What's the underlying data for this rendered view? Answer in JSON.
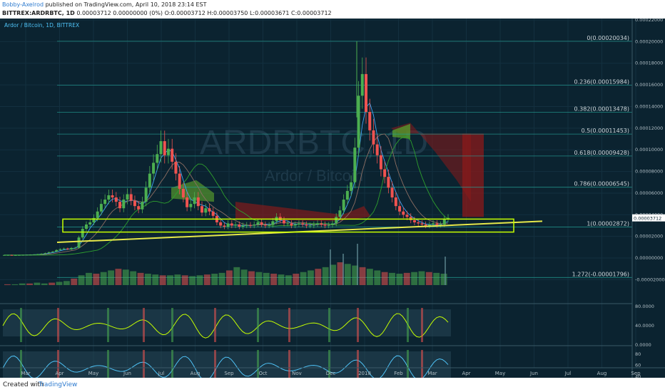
{
  "header": {
    "author": "Bobby-Axelrod",
    "published": " published on TradingView.com, April 10, 2018 23:14 EST",
    "symbol": "BITTREX:ARDRBTC, 1D",
    "ohlc": " 0.00003712 0.00000000 (0%) O:0.00003712 H:0.00003750 L:0.00003671 C:0.00003712"
  },
  "chart_title": "Ardor / Bitcoin, 1D, BITTREX",
  "watermark": {
    "symbol": "ARDRBTC, 1D",
    "name": "Ardor / Bitcoin"
  },
  "footer": {
    "created": "Created with",
    "brand": "TradingView"
  },
  "colors": {
    "background": "#0b2330",
    "candle_up": "#4caf50",
    "candle_down": "#ef5350",
    "fib_line": "#26a69a",
    "trendline": "#e6e84a",
    "support_box": "#c6ff00",
    "cloud_bear": "#8b1a1a",
    "cloud_bull": "#5aa02c",
    "price_tag": "#ffffff"
  },
  "chart_data": [
    {
      "type": "candlestick",
      "title": "Ardor / Bitcoin, 1D, BITTREX",
      "x_tick_labels": [
        "Mar",
        "Apr",
        "May",
        "Jun",
        "Jul",
        "Aug",
        "Sep",
        "Oct",
        "Nov",
        "Dec",
        "2018",
        "Feb",
        "Mar",
        "Apr",
        "May",
        "Jun",
        "Jul",
        "Aug",
        "Sep"
      ],
      "y_tick_labels": [
        "0.00022000",
        "0.00020000",
        "0.00018000",
        "0.00016000",
        "0.00014000",
        "0.00012000",
        "0.00010000",
        "0.00008000",
        "0.00006000",
        "0.00004000",
        "0.00002000",
        "0.00000000",
        "-0.00002000"
      ],
      "ylim": [
        -2.5e-05,
        0.00022
      ],
      "current_price_label": "0.00003712",
      "current_price": 3.712e-05,
      "fib_levels": [
        {
          "label": "0(0.00020034)",
          "value": 0.00020034
        },
        {
          "label": "0.236(0.00015984)",
          "value": 0.00015984
        },
        {
          "label": "0.382(0.00013478)",
          "value": 0.00013478
        },
        {
          "label": "0.5(0.00011453)",
          "value": 0.00011453
        },
        {
          "label": "0.618(0.00009428)",
          "value": 9.428e-05
        },
        {
          "label": "0.786(0.00006545)",
          "value": 6.545e-05
        },
        {
          "label": "1(0.00002872)",
          "value": 2.872e-05
        },
        {
          "label": "1.272(-0.00001796)",
          "value": -1.796e-05
        }
      ],
      "close_series": [
        2.8e-06,
        2.8e-06,
        2.7e-06,
        2.7e-06,
        2.8e-06,
        2.9e-06,
        3e-06,
        3.1e-06,
        3.3e-06,
        3.6e-06,
        4e-06,
        4.6e-06,
        5.4e-06,
        6e-06,
        7.4e-06,
        8.2e-06,
        8.8e-06,
        8e-06,
        9.3e-06,
        9.5e-06,
        1.9e-05,
        2.7e-05,
        3.1e-05,
        3.3e-05,
        3.7e-05,
        4.3e-05,
        5e-05,
        5.4e-05,
        5.8e-05,
        5.6e-05,
        5.2e-05,
        4.6e-05,
        5.4e-05,
        5.9e-05,
        5.3e-05,
        4.8e-05,
        4.5e-05,
        5.2e-05,
        6.5e-05,
        7.8e-05,
        8.8e-05,
        9.6e-05,
        0.000108,
        9.5e-05,
        0.000101,
        8.9e-05,
        7.8e-05,
        6.4e-05,
        5.6e-05,
        4.7e-05,
        5e-05,
        5.6e-05,
        4.8e-05,
        4.2e-05,
        4.6e-05,
        4.3e-05,
        3.9e-05,
        3.3e-05,
        3e-05,
        2.9e-05,
        3.2e-05,
        3e-05,
        3.1e-05,
        2.9e-05,
        3e-05,
        3.05e-05,
        3e-05,
        3.1e-05,
        3.3e-05,
        3.1e-05,
        3e-05,
        3.05e-05,
        3.4e-05,
        3.8e-05,
        3.5e-05,
        3.2e-05,
        3.2e-05,
        3e-05,
        3.1e-05,
        3.2e-05,
        3.1e-05,
        3e-05,
        3e-05,
        3.1e-05,
        3.2e-05,
        3.1e-05,
        3e-05,
        3.05e-05,
        3.2e-05,
        3.8e-05,
        4.4e-05,
        5.4e-05,
        6.2e-05,
        7e-05,
        0.000102,
        0.00015,
        0.00017,
        0.000135,
        0.000118,
        0.000105,
        9.5e-05,
        8.2e-05,
        7.5e-05,
        6.5e-05,
        5.6e-05,
        4.8e-05,
        4.3e-05,
        4e-05,
        3.8e-05,
        3.5e-05,
        3.3e-05,
        3.2e-05,
        3.1e-05,
        3e-05,
        3.1e-05,
        3.2e-05,
        3.05e-05,
        3.1e-05,
        3.6e-05,
        3.71e-05
      ],
      "volume_values": [
        1,
        1,
        2,
        2,
        3,
        2,
        3,
        4,
        5,
        8,
        12,
        15,
        14,
        16,
        18,
        20,
        19,
        17,
        15,
        14,
        13,
        12,
        12,
        13,
        12,
        11,
        12,
        13,
        14,
        15,
        18,
        22,
        19,
        17,
        16,
        15,
        14,
        13,
        12,
        14,
        16,
        18,
        20,
        22,
        25,
        28,
        26,
        24,
        22,
        20,
        18,
        16,
        15,
        14,
        15,
        16,
        17,
        16,
        15,
        14
      ],
      "rsi_ylim": [
        0,
        80
      ],
      "rsi_tick_labels": [
        "80.0000",
        "40.0000",
        "0.0000"
      ],
      "stoch_ylim": [
        20,
        90
      ],
      "stoch_tick_labels": [
        "80",
        "60",
        "40"
      ]
    }
  ]
}
